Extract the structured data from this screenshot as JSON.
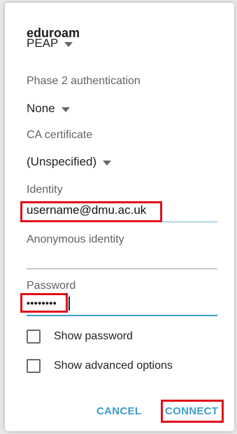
{
  "dialog": {
    "title": "eduroam"
  },
  "eap": {
    "value": "PEAP"
  },
  "phase2": {
    "label": "Phase 2 authentication",
    "value": "None"
  },
  "ca_cert": {
    "label": "CA certificate",
    "value": "(Unspecified)"
  },
  "identity": {
    "label": "Identity",
    "value": "username@dmu.ac.uk"
  },
  "anonymous_identity": {
    "label": "Anonymous identity",
    "value": ""
  },
  "password": {
    "label": "Password",
    "value": "••••••••"
  },
  "options": [
    {
      "label": "Show password",
      "checked": false
    },
    {
      "label": "Show advanced options",
      "checked": false
    }
  ],
  "buttons": {
    "cancel": "CANCEL",
    "connect": "CONNECT"
  },
  "colors": {
    "accent": "#3c9cc9",
    "highlight_box": "#e0101b"
  },
  "icons": {
    "dropdown": "caret-down-icon",
    "checkbox": "checkbox-unchecked-icon"
  }
}
